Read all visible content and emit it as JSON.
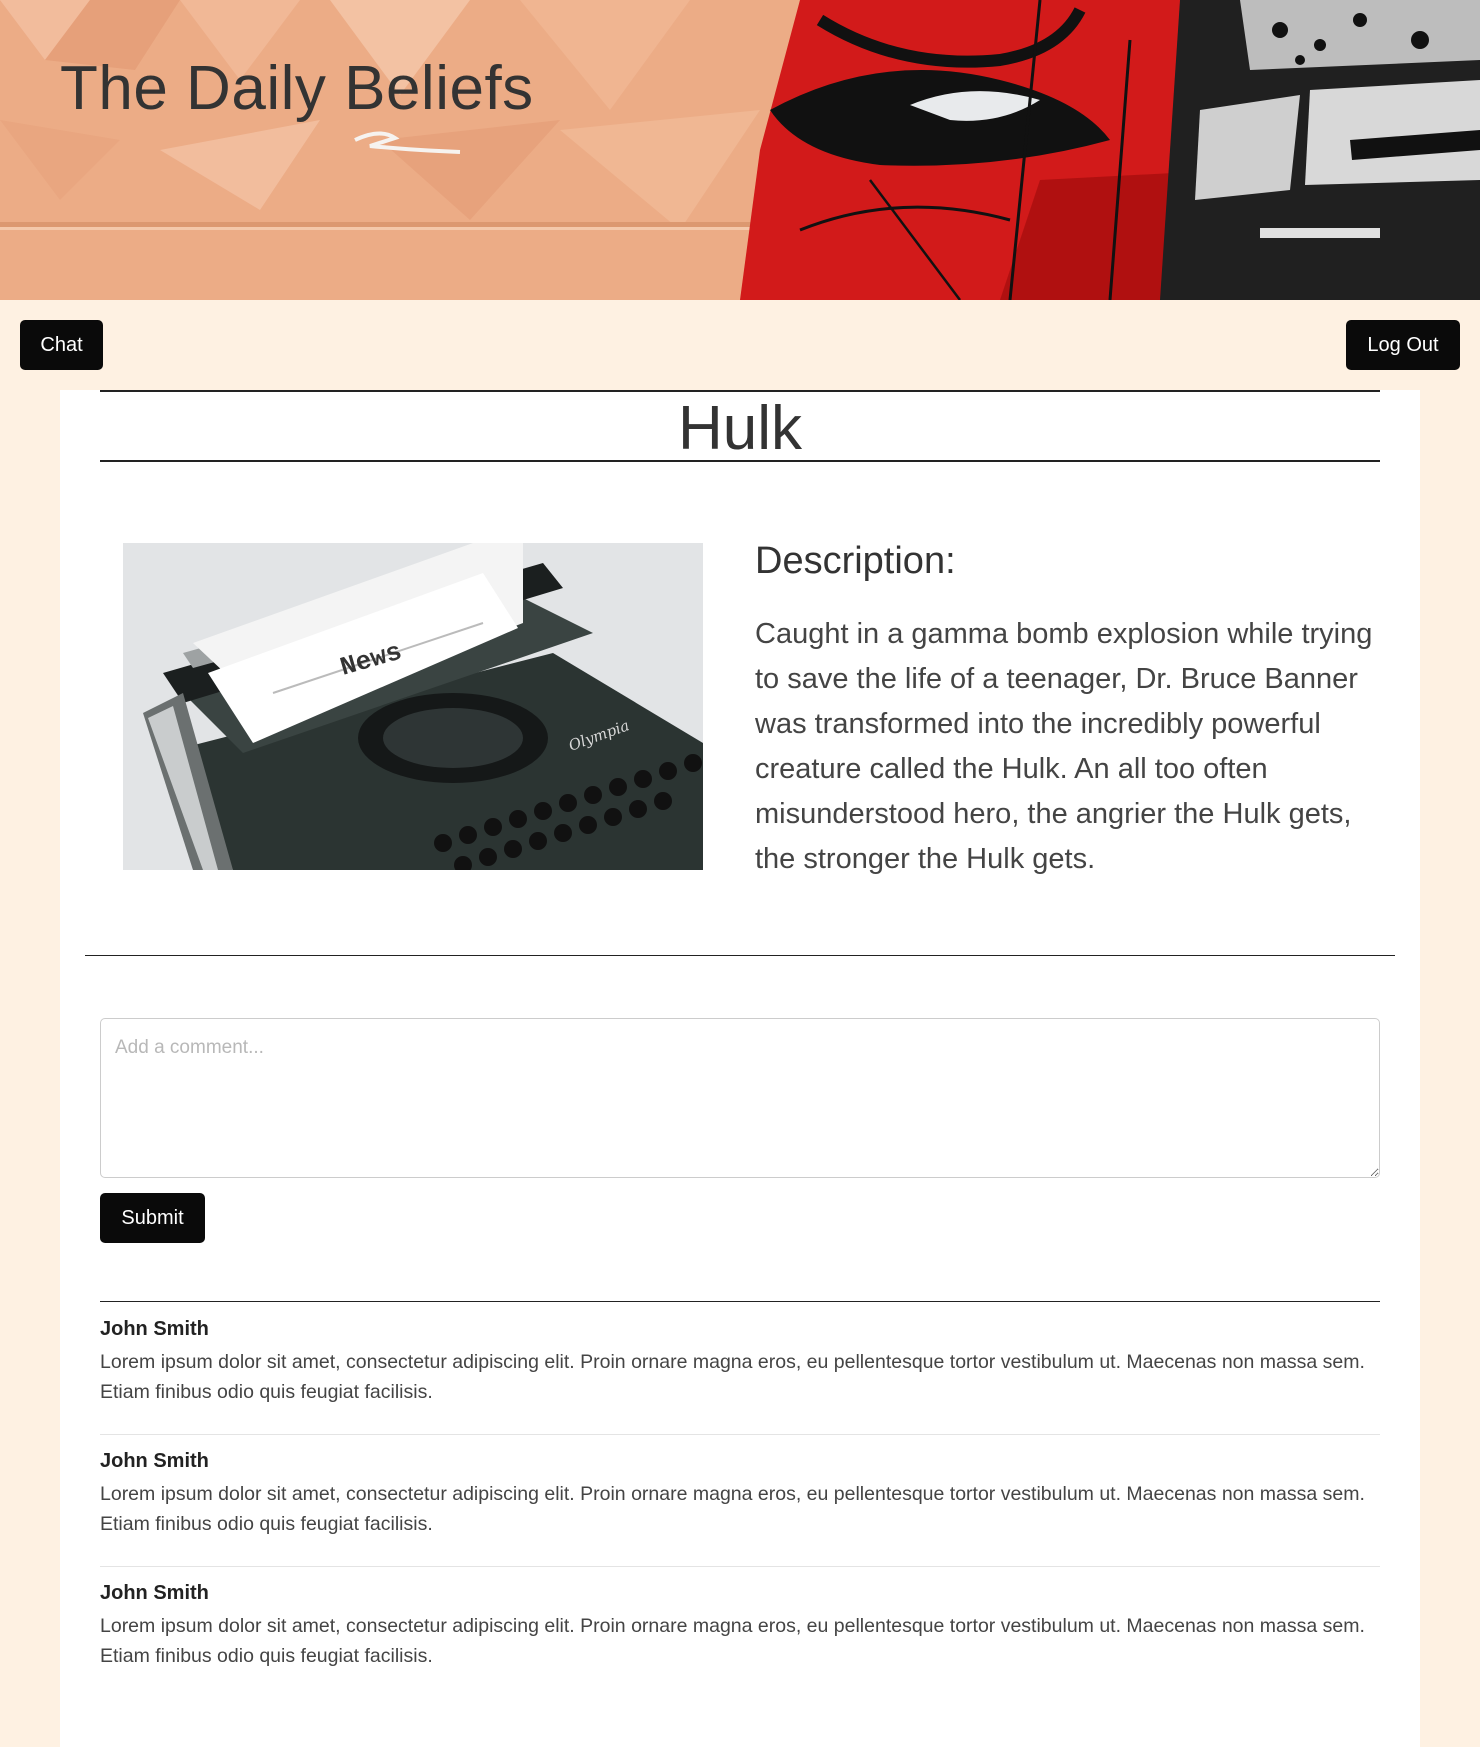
{
  "site": {
    "title": "The Daily Beliefs"
  },
  "nav": {
    "chat_label": "Chat",
    "logout_label": "Log Out"
  },
  "article": {
    "title": "Hulk",
    "description_heading": "Description:",
    "description": "Caught in a gamma bomb explosion while trying to save the life of a teenager, Dr. Bruce Banner was transformed into the incredibly powerful creature called the Hulk. An all too often misunderstood hero, the angrier the Hulk gets, the stronger the Hulk gets.",
    "image_text": "News",
    "image_brand": "Olympia"
  },
  "comment_form": {
    "placeholder": "Add a comment...",
    "value": "",
    "submit_label": "Submit"
  },
  "comments": [
    {
      "author": "John Smith",
      "body": "Lorem ipsum dolor sit amet, consectetur adipiscing elit. Proin ornare magna eros, eu pellentesque tortor vestibulum ut. Maecenas non massa sem. Etiam finibus odio quis feugiat facilisis."
    },
    {
      "author": "John Smith",
      "body": "Lorem ipsum dolor sit amet, consectetur adipiscing elit. Proin ornare magna eros, eu pellentesque tortor vestibulum ut. Maecenas non massa sem. Etiam finibus odio quis feugiat facilisis."
    },
    {
      "author": "John Smith",
      "body": "Lorem ipsum dolor sit amet, consectetur adipiscing elit. Proin ornare magna eros, eu pellentesque tortor vestibulum ut. Maecenas non massa sem. Etiam finibus odio quis feugiat facilisis."
    }
  ],
  "colors": {
    "page_background": "#fef1e2",
    "card_background": "#ffffff",
    "button_background": "#0a0a0a",
    "banner_peach": "#ecac86",
    "banner_red": "#d21a1a"
  }
}
